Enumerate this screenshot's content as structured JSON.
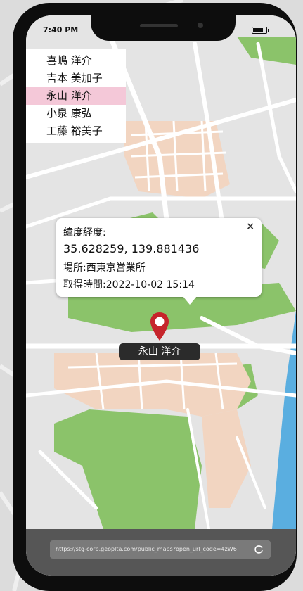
{
  "status_bar": {
    "time": "7:40 PM"
  },
  "people_list": {
    "items": [
      {
        "name": "喜嶋 洋介",
        "selected": false
      },
      {
        "name": "吉本 美加子",
        "selected": false
      },
      {
        "name": "永山 洋介",
        "selected": true
      },
      {
        "name": "小泉 康弘",
        "selected": false
      },
      {
        "name": "工藤 裕美子",
        "selected": false
      }
    ]
  },
  "popup": {
    "line1": "緯度経度:",
    "line2": "35.628259, 139.881436",
    "line3": "場所:西東京営業所",
    "line4": "取得時間:2022-10-02 15:14",
    "close_symbol": "×"
  },
  "marker": {
    "label": "永山 洋介",
    "color": "#c6252b"
  },
  "url_bar": {
    "url": "https://stg-corp.geoplta.com/public_maps?open_url_code=4zW6"
  },
  "colors": {
    "map_base": "#e6e6e6",
    "park": "#8bc36a",
    "residential": "#f2d5c1",
    "road": "#ffffff",
    "water": "#5aaee0",
    "bottom_bar": "#565656"
  },
  "icons": {
    "refresh": "refresh-icon",
    "close": "close-icon",
    "pin": "map-pin-icon"
  }
}
